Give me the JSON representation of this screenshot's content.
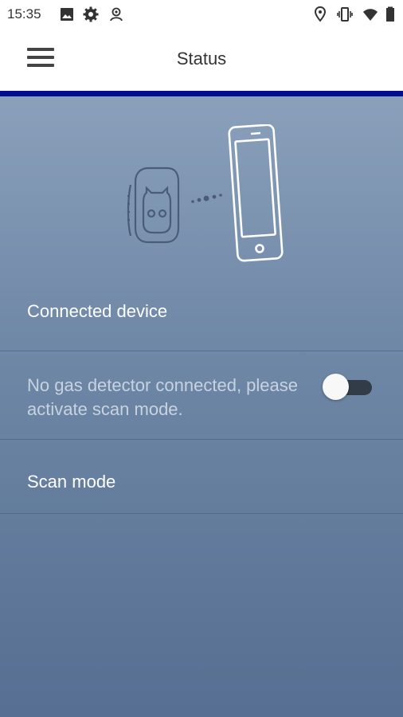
{
  "statusbar": {
    "time": "15:35",
    "left_icons": [
      "image-icon",
      "gear-icon",
      "account-icon"
    ],
    "right_icons": [
      "location-icon",
      "vibrate-icon",
      "wifi-icon",
      "battery-icon"
    ]
  },
  "appbar": {
    "title": "Status",
    "menu_icon": "hamburger-menu-icon",
    "accent_color": "#000e8f"
  },
  "illustration": {
    "device_icon": "gas-detector-icon",
    "phone_icon": "smartphone-icon",
    "link_icon": "connection-dots-icon"
  },
  "connected_device": {
    "label": "Connected device",
    "message": "No gas detector connected, please activate scan mode."
  },
  "scan_mode": {
    "label": "Scan mode",
    "enabled": false
  }
}
